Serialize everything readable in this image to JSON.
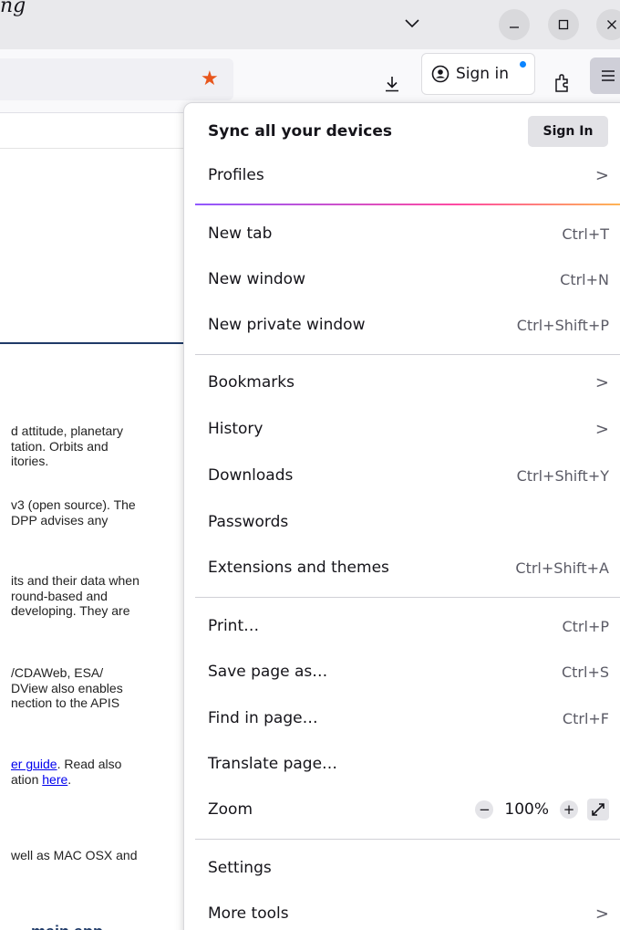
{
  "titlebar": {
    "title_fragment": "ng",
    "list_tabs_icon": "chevron-down-icon",
    "window_controls": {
      "minimize": "minimize-icon",
      "maximize": "maximize-icon",
      "close": "close-icon"
    }
  },
  "navbar": {
    "bookmark_icon": "star-icon",
    "bookmark_color": "#e8561c",
    "signin_label": "Sign in",
    "signin_dot_color": "#0a84ff"
  },
  "page": {
    "paragraphs": [
      {
        "lines": [
          "d attitude, planetary",
          "tation. Orbits and",
          "itories."
        ]
      },
      {
        "lines": [
          "v3 (open source). The",
          "DPP advises any"
        ]
      },
      {
        "lines": [
          "its and their data when",
          "round-based and",
          "developing. They are"
        ]
      },
      {
        "lines": [
          "/CDAWeb, ESA/",
          "DView also enables",
          "nection to the APIS"
        ]
      },
      {
        "line1_link": "er guide",
        "line1_tail": ". Read also",
        "line2_text": "ation ",
        "line2_link": "here",
        "line2_tail": "."
      },
      {
        "lines": [
          "well as MAC OSX and"
        ]
      }
    ],
    "bottom_fragment": "main app"
  },
  "menu": {
    "sync_title": "Sync all your devices",
    "sync_signin": "Sign In",
    "profiles": "Profiles",
    "gradient": [
      "#9059ff",
      "#ff4aa2",
      "#ffbd4f"
    ],
    "items": {
      "new_tab": {
        "label": "New tab",
        "shortcut": "Ctrl+T"
      },
      "new_window": {
        "label": "New window",
        "shortcut": "Ctrl+N"
      },
      "new_private": {
        "label": "New private window",
        "shortcut": "Ctrl+Shift+P"
      },
      "bookmarks": {
        "label": "Bookmarks"
      },
      "history": {
        "label": "History"
      },
      "downloads": {
        "label": "Downloads",
        "shortcut": "Ctrl+Shift+Y"
      },
      "passwords": {
        "label": "Passwords"
      },
      "extensions": {
        "label": "Extensions and themes",
        "shortcut": "Ctrl+Shift+A"
      },
      "print": {
        "label": "Print…",
        "shortcut": "Ctrl+P"
      },
      "save_page": {
        "label": "Save page as…",
        "shortcut": "Ctrl+S"
      },
      "find": {
        "label": "Find in page…",
        "shortcut": "Ctrl+F"
      },
      "translate": {
        "label": "Translate page…"
      },
      "zoom": {
        "label": "Zoom",
        "minus": "−",
        "value": "100%",
        "plus": "+"
      },
      "settings": {
        "label": "Settings"
      },
      "more_tools": {
        "label": "More tools"
      }
    },
    "chevron": ">"
  }
}
